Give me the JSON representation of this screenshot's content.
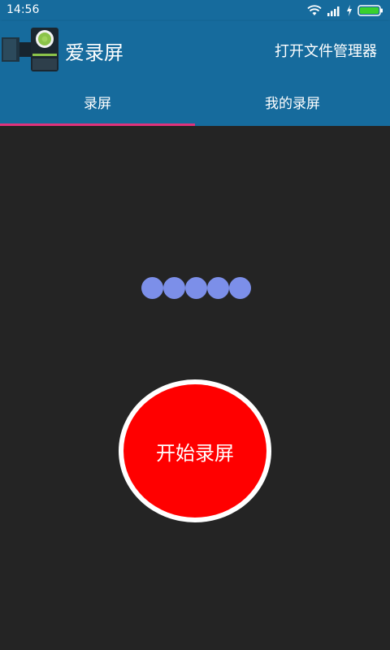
{
  "status_bar": {
    "time": "14:56",
    "icons": [
      "wifi-icon",
      "signal-icon",
      "charging-icon",
      "battery-icon"
    ]
  },
  "app_bar": {
    "title": "爱录屏",
    "action_label": "打开文件管理器",
    "logo_icon": "camera-logo-icon"
  },
  "tabs": [
    {
      "label": "录屏",
      "selected": true
    },
    {
      "label": "我的录屏",
      "selected": false
    }
  ],
  "loading_dots": {
    "count": 5,
    "color": "#7c8fe9"
  },
  "record_button": {
    "label": "开始录屏",
    "color": "#ff0000"
  },
  "colors": {
    "primary": "#166b9d",
    "background": "#242424",
    "tab_indicator": "#e0327c"
  }
}
